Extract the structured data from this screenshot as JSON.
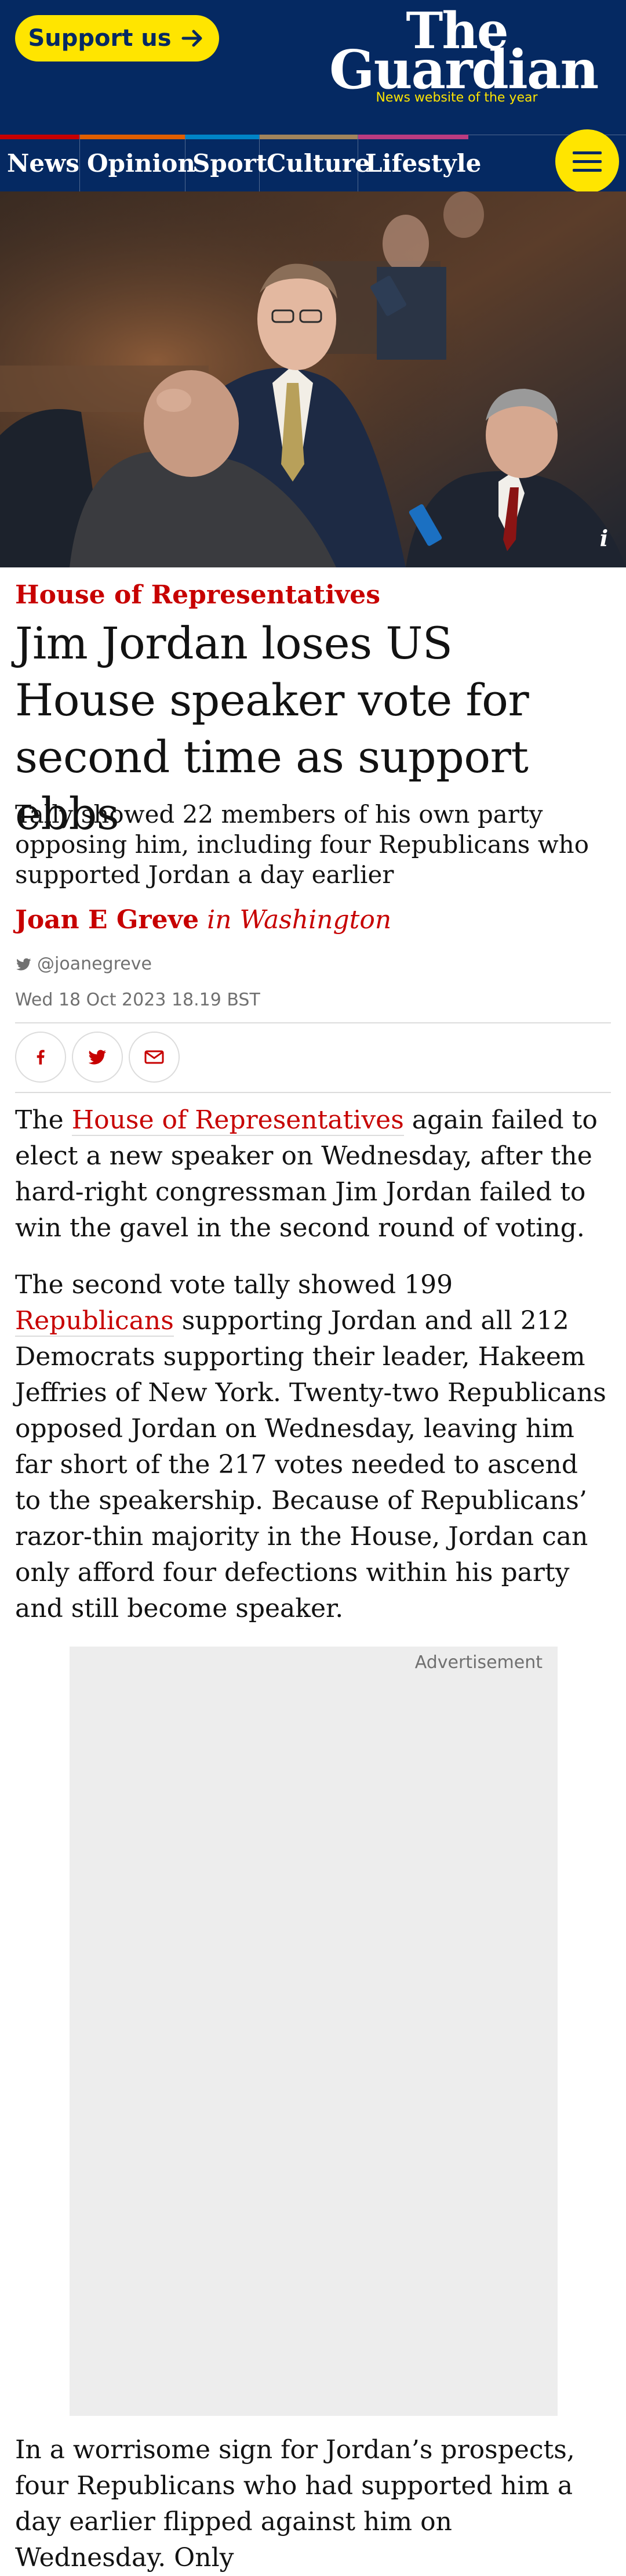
{
  "header": {
    "support_label": "Support us",
    "logo_line1": "The",
    "logo_line2": "Guardian",
    "tagline": "News website of the year"
  },
  "nav": {
    "pillars": [
      {
        "label": "News",
        "color": "#c70000"
      },
      {
        "label": "Opinion",
        "color": "#e05e00"
      },
      {
        "label": "Sport",
        "color": "#0084c6"
      },
      {
        "label": "Culture",
        "color": "#a1845c"
      },
      {
        "label": "Lifestyle",
        "color": "#bb3b80"
      }
    ]
  },
  "hero": {
    "info_icon_label": "i"
  },
  "article": {
    "kicker": "House of Representatives",
    "headline": "Jim Jordan loses US House speaker vote for second time as support ebbs",
    "standfirst": "Tally showed 22 members of his own party opposing him, including four Republicans who supported Jordan a day earlier",
    "byline_name": "Joan E Greve",
    "byline_location": "in Washington",
    "twitter_handle": "@joanegreve",
    "date": "Wed 18 Oct 2023 18.19 BST",
    "share": [
      "facebook",
      "twitter",
      "email"
    ],
    "p1_before": "The ",
    "p1_link": "House of Representatives",
    "p1_after": " again failed to elect a new speaker on Wednesday, after the hard-right congressman Jim Jordan failed to win the gavel in the second round of voting.",
    "p2_before": "The second vote tally showed 199 ",
    "p2_link": "Republicans",
    "p2_after": " supporting Jordan and all 212 Democrats supporting their leader, Hakeem Jeffries of New York. Twenty-two Republicans opposed Jordan on Wednesday, leaving him far short of the 217 votes needed to ascend to the speakership. Because of Republicans’ razor-thin majority in the House, Jordan can only afford four defections within his party and still become speaker.",
    "ad_label": "Advertisement",
    "p3": "In a worrisome sign for Jordan’s prospects, four Republicans who had supported him a day earlier flipped against him on Wednesday. Only"
  },
  "colors": {
    "brand_blue": "#052962",
    "brand_yellow": "#ffe500",
    "news_red": "#c70000"
  }
}
